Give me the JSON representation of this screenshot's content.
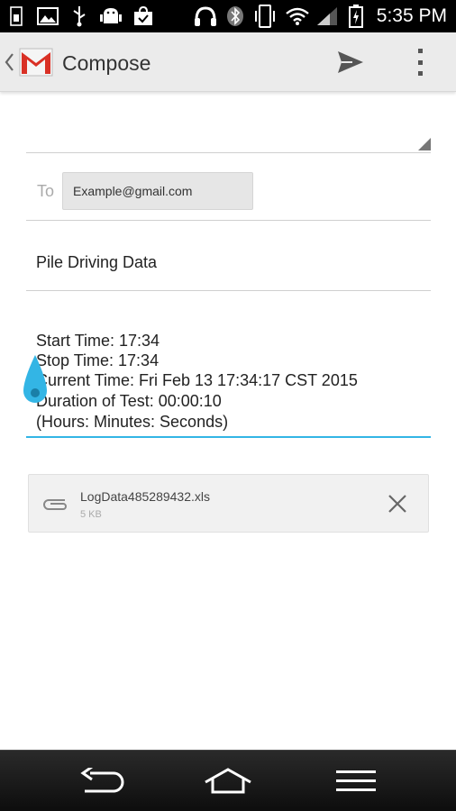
{
  "status_bar": {
    "time": "5:35 PM",
    "icons": [
      "usb-icon",
      "image-icon",
      "usb-debug-icon",
      "android-icon",
      "shopping-bag-icon",
      "headset-icon",
      "bluetooth-icon",
      "vibrate-icon",
      "wifi-icon",
      "signal-icon",
      "battery-charging-icon"
    ]
  },
  "action_bar": {
    "title": "Compose",
    "icons": [
      "back-chevron-icon",
      "gmail-icon",
      "send-icon",
      "overflow-menu-icon"
    ]
  },
  "compose": {
    "to_label": "To",
    "to_recipient": "Example@gmail.com",
    "subject": "Pile Driving Data",
    "body_lines": [
      "Start Time: 17:34",
      "Stop Time: 17:34",
      "Current Time: Fri Feb 13 17:34:17 CST 2015",
      "Duration of Test: 00:00:10",
      "(Hours: Minutes: Seconds)"
    ]
  },
  "attachment": {
    "filename": "LogData485289432.xls",
    "size": "5 KB",
    "icons": [
      "paperclip-icon",
      "close-icon"
    ]
  },
  "nav_bar": {
    "icons": [
      "back-icon",
      "home-icon",
      "menu-icon"
    ]
  },
  "colors": {
    "accent": "#33b5e5",
    "gmail_red": "#d93025"
  }
}
